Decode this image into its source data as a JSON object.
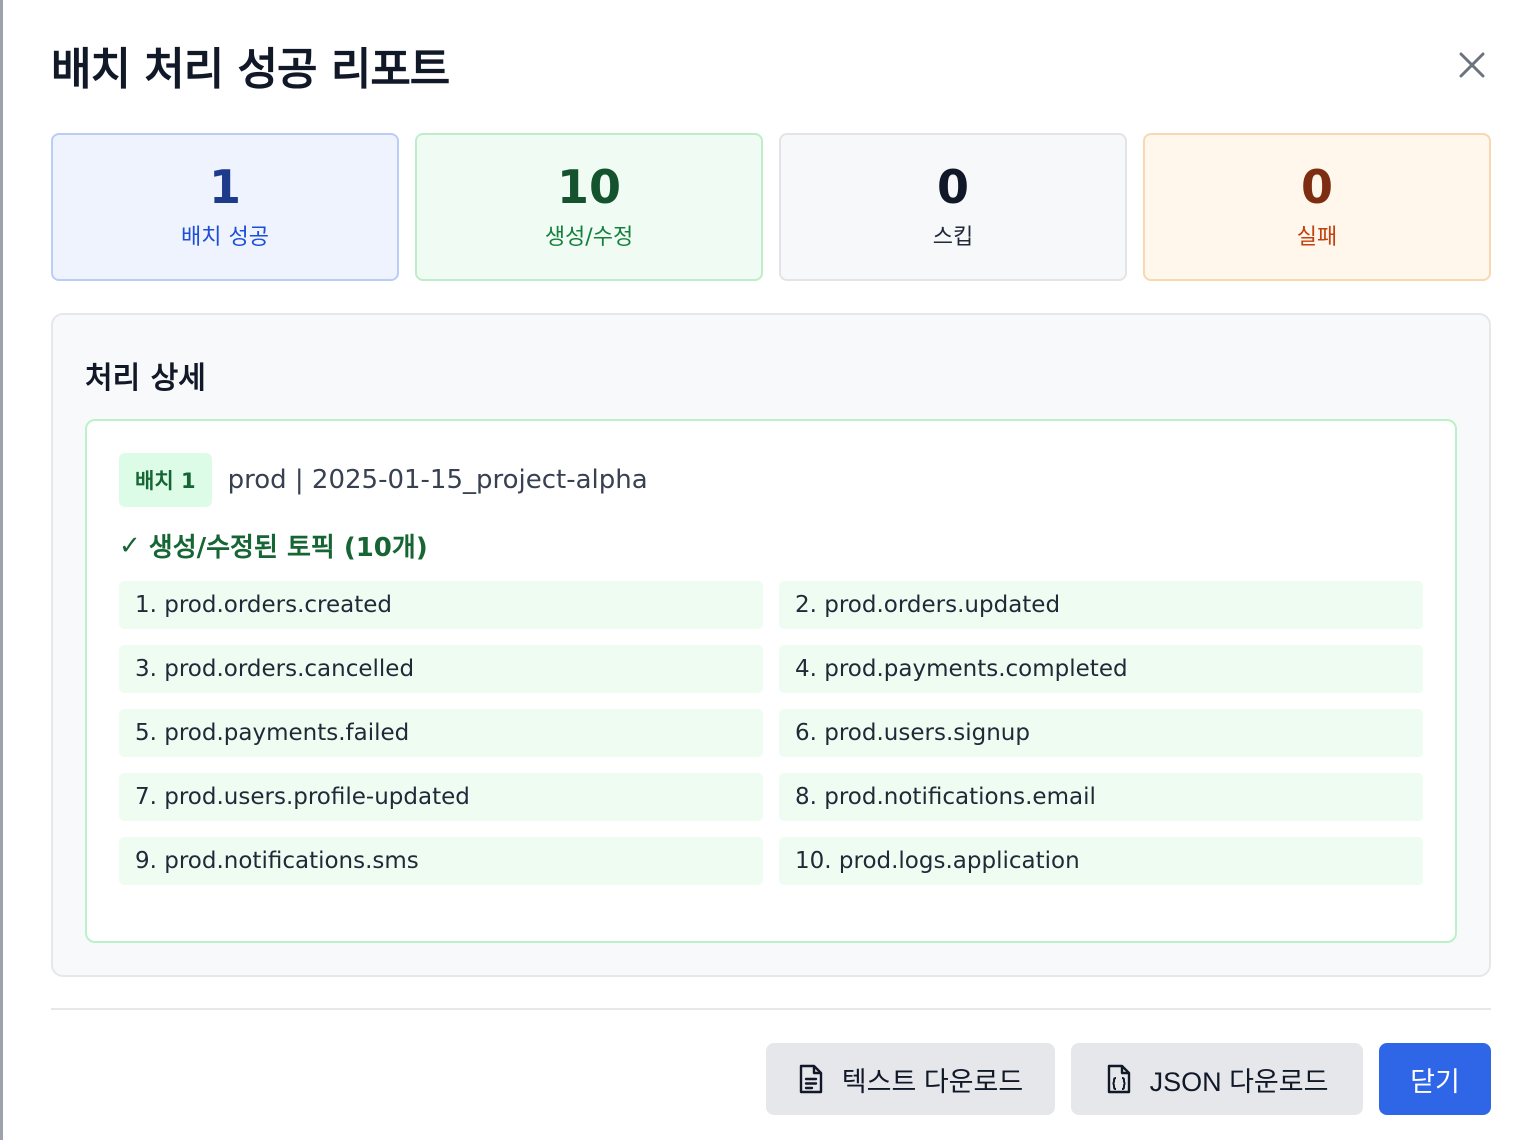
{
  "header": {
    "title": "배치 처리 성공 리포트",
    "close_icon": "close-icon"
  },
  "stats": [
    {
      "value": "1",
      "label": "배치 성공",
      "color": "#1e3a8a"
    },
    {
      "value": "10",
      "label": "생성/수정",
      "color": "#14532d"
    },
    {
      "value": "0",
      "label": "스킵",
      "color": "#111827"
    },
    {
      "value": "0",
      "label": "실패",
      "color": "#7c2d12"
    }
  ],
  "details": {
    "title": "처리 상세",
    "batch": {
      "badge": "배치 1",
      "info": "prod | 2025-01-15_project-alpha",
      "section_check": "✓",
      "section_title": "생성/수정된 토픽 (10개)",
      "topics": [
        "1. prod.orders.created",
        "2. prod.orders.updated",
        "3. prod.orders.cancelled",
        "4. prod.payments.completed",
        "5. prod.payments.failed",
        "6. prod.users.signup",
        "7. prod.users.profile-updated",
        "8. prod.notifications.email",
        "9. prod.notifications.sms",
        "10. prod.logs.application"
      ]
    }
  },
  "footer": {
    "text_download": "텍스트 다운로드",
    "json_download": "JSON 다운로드",
    "close": "닫기",
    "primary_color": "#2f66e8"
  }
}
